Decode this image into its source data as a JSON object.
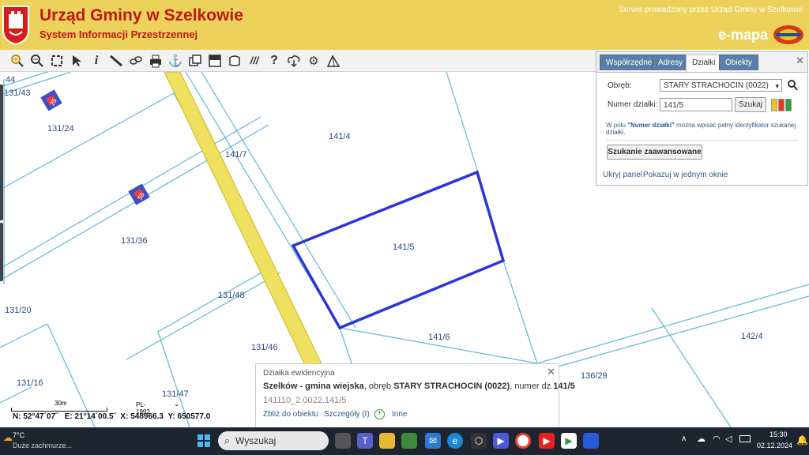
{
  "header": {
    "title": "Urząd Gminy w Szelkowie",
    "subtitle": "System Informacji Przestrzennej",
    "service": "Serwis prowadzony przez Urząd Gminy w Szelkowie",
    "brand": "e-mapa",
    "colors": {
      "background": "#ecd15a",
      "title": "#c01818"
    }
  },
  "toolbar": {
    "icons": [
      "zoom-in-icon",
      "zoom-out-icon",
      "zoom-extent-icon",
      "pointer-icon",
      "info-icon",
      "measure-icon",
      "link-icon",
      "print-icon",
      "anchor-icon",
      "layers-icon",
      "grid-icon",
      "shape-icon",
      "hatch-icon",
      "help-icon",
      "download-icon",
      "settings-icon",
      "terrain-icon"
    ]
  },
  "map": {
    "parcels": [
      "131/43",
      "131/24",
      "141/4",
      "141/7",
      "131/36",
      "141/5",
      "131/48",
      "131/20",
      "131/46",
      "141/6",
      "136/29",
      "142/4",
      "131/16",
      "131/47"
    ],
    "edge_label": "44",
    "house_numbers": [
      "25",
      "55"
    ],
    "highlight_color": "#2b35d8",
    "road_color": "#f0e060"
  },
  "panel": {
    "tabs": [
      "Współrzędne",
      "Adresy",
      "Działki",
      "Obiekty"
    ],
    "active_tab": "Działki",
    "obreb_label": "Obręb:",
    "obreb_value": "STARY STRACHOCIN (0022)",
    "numer_label": "Numer działki:",
    "numer_value": "141/5",
    "search_button": "Szukaj",
    "hint_prefix": "W polu ",
    "hint_bold": "\"Numer działki\"",
    "hint_suffix": " można wpisać pełny identyfikator szukanej działki.",
    "advanced_button": "Szukanie zaawansowane",
    "hide_link": "Ukryj panel",
    "show_link": "Pokazuj w jednym oknie"
  },
  "popup": {
    "heading": "Działka ewidencyjna",
    "place": "Szelków - gmina wiejska",
    "obreb_text": ", obręb ",
    "obreb_name": "STARY STRACHOCIN (0022)",
    "numer_text": ", numer dz.",
    "numer": "141/5",
    "identifier": "141110_2.0022.141/5",
    "zoom_link": "Zbliż do obiektu",
    "details_link": "Szczegóły (I)",
    "more_link": "Inne"
  },
  "scale": {
    "label": "30m",
    "projection": "PL-1992"
  },
  "coords": {
    "n": "N: 52°47´07˝",
    "e": "E: 21°14´00.5˝",
    "x": "X: 548966.3",
    "y": "Y: 650577.0"
  },
  "taskbar": {
    "weather_temp": "7°C",
    "weather_text": "Duże zachmurze...",
    "search_placeholder": "Wyszukaj",
    "time": "15:30",
    "date": "02.12.2024"
  }
}
